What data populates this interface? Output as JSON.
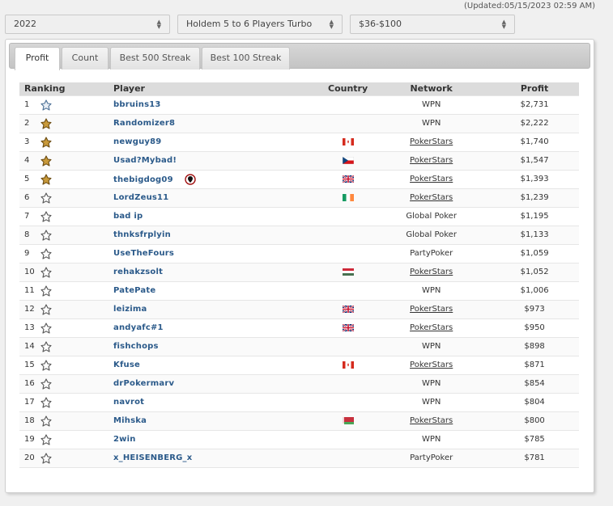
{
  "updated": "(Updated:05/15/2023 02:59 AM)",
  "filters": {
    "year": "2022",
    "game": "Holdem 5 to 6 Players Turbo",
    "stakes": "$36-$100"
  },
  "tabs": [
    {
      "label": "Profit",
      "active": true
    },
    {
      "label": "Count",
      "active": false
    },
    {
      "label": "Best 500 Streak",
      "active": false
    },
    {
      "label": "Best 100 Streak",
      "active": false
    }
  ],
  "table": {
    "headers": {
      "ranking": "Ranking",
      "player": "Player",
      "country": "Country",
      "network": "Network",
      "profit": "Profit"
    },
    "rows": [
      {
        "rank": "1",
        "icon": "blue-shark-icon",
        "player": "bbruins13",
        "flag": "",
        "network": "WPN",
        "network_link": false,
        "profit": "$2,731"
      },
      {
        "rank": "2",
        "icon": "gold-shark-icon",
        "player": "Randomizer8",
        "flag": "",
        "network": "WPN",
        "network_link": false,
        "profit": "$2,222"
      },
      {
        "rank": "3",
        "icon": "gold-shark-icon",
        "player": "newguy89",
        "flag": "canada-flag-icon",
        "network": "PokerStars",
        "network_link": true,
        "profit": "$1,740"
      },
      {
        "rank": "4",
        "icon": "gold-shark-icon",
        "player": "Usad?Mybad!",
        "flag": "czech-flag-icon",
        "network": "PokerStars",
        "network_link": true,
        "profit": "$1,547"
      },
      {
        "rank": "5",
        "icon": "gold-shark-icon",
        "player": "thebigdog09",
        "flag": "uk-flag-icon",
        "network": "PokerStars",
        "network_link": true,
        "profit": "$1,393",
        "pin": true
      },
      {
        "rank": "6",
        "icon": "silver-shark-icon",
        "player": "LordZeus11",
        "flag": "ireland-flag-icon",
        "network": "PokerStars",
        "network_link": true,
        "profit": "$1,239"
      },
      {
        "rank": "7",
        "icon": "silver-shark-icon",
        "player": "bad ip",
        "flag": "",
        "network": "Global Poker",
        "network_link": false,
        "profit": "$1,195"
      },
      {
        "rank": "8",
        "icon": "silver-shark-icon",
        "player": "thnksfrplyin",
        "flag": "",
        "network": "Global Poker",
        "network_link": false,
        "profit": "$1,133"
      },
      {
        "rank": "9",
        "icon": "silver-shark-icon",
        "player": "UseTheFours",
        "flag": "",
        "network": "PartyPoker",
        "network_link": false,
        "profit": "$1,059"
      },
      {
        "rank": "10",
        "icon": "silver-shark-icon",
        "player": "rehakzsolt",
        "flag": "hungary-flag-icon",
        "network": "PokerStars",
        "network_link": true,
        "profit": "$1,052"
      },
      {
        "rank": "11",
        "icon": "silver-shark-icon",
        "player": "PatePate",
        "flag": "",
        "network": "WPN",
        "network_link": false,
        "profit": "$1,006"
      },
      {
        "rank": "12",
        "icon": "silver-shark-icon",
        "player": "leizima",
        "flag": "uk-flag-icon",
        "network": "PokerStars",
        "network_link": true,
        "profit": "$973"
      },
      {
        "rank": "13",
        "icon": "silver-shark-icon",
        "player": "andyafc#1",
        "flag": "uk-flag-icon",
        "network": "PokerStars",
        "network_link": true,
        "profit": "$950"
      },
      {
        "rank": "14",
        "icon": "silver-shark-icon",
        "player": "fishchops",
        "flag": "",
        "network": "WPN",
        "network_link": false,
        "profit": "$898"
      },
      {
        "rank": "15",
        "icon": "silver-shark-icon",
        "player": "Kfuse",
        "flag": "canada-flag-icon",
        "network": "PokerStars",
        "network_link": true,
        "profit": "$871"
      },
      {
        "rank": "16",
        "icon": "silver-shark-icon",
        "player": "drPokermarv",
        "flag": "",
        "network": "WPN",
        "network_link": false,
        "profit": "$854"
      },
      {
        "rank": "17",
        "icon": "silver-shark-icon",
        "player": "navrot",
        "flag": "",
        "network": "WPN",
        "network_link": false,
        "profit": "$804"
      },
      {
        "rank": "18",
        "icon": "silver-shark-icon",
        "player": "Mihska",
        "flag": "belarus-flag-icon",
        "network": "PokerStars",
        "network_link": true,
        "profit": "$800"
      },
      {
        "rank": "19",
        "icon": "silver-shark-icon",
        "player": "2win",
        "flag": "",
        "network": "WPN",
        "network_link": false,
        "profit": "$785"
      },
      {
        "rank": "20",
        "icon": "silver-shark-icon",
        "player": "x_HEISENBERG_x",
        "flag": "",
        "network": "PartyPoker",
        "network_link": false,
        "profit": "$781"
      }
    ]
  }
}
